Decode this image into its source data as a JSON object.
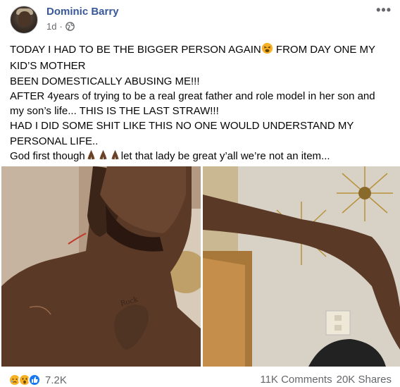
{
  "post": {
    "author": "Dominic Barry",
    "time": "1d",
    "separator": "·",
    "more_label": "•••",
    "lines": [
      "TODAY I HAD TO BE THE BIGGER PERSON AGAIN",
      " FROM DAY ONE MY",
      "KID’S MOTHER",
      "BEEN DOMESTICALLY ABUSING ME!!!",
      "AFTER 4years of trying to be a real great father and role model in her son and",
      "my son’s life... THIS IS THE LAST STRAW!!!",
      "HAD I DID SOME SHIT LIKE THIS NO ONE WOULD UNDERSTAND MY",
      "PERSONAL LIFE..",
      "God first though",
      "let that lady be great y’all we’re not an item..."
    ],
    "photos": [
      {
        "subject": "man-neck-chest-scratches"
      },
      {
        "subject": "arm-with-sunburst-mirror"
      }
    ]
  },
  "footer": {
    "reaction_count": "7.2K",
    "comments": "11K Comments",
    "shares": "20K Shares"
  },
  "colors": {
    "author": "#385898",
    "meta": "#65676b",
    "text": "#050505",
    "like_blue": "#1877f2",
    "reaction_yellow": "#f7b125"
  },
  "icons": {
    "privacy": "globe-icon",
    "options": "more-options-icon",
    "reactions": [
      "sad-reaction-icon",
      "wow-reaction-icon",
      "like-reaction-icon"
    ],
    "inline_emojis": [
      "weary-face-emoji",
      "folded-hands-emoji"
    ]
  }
}
